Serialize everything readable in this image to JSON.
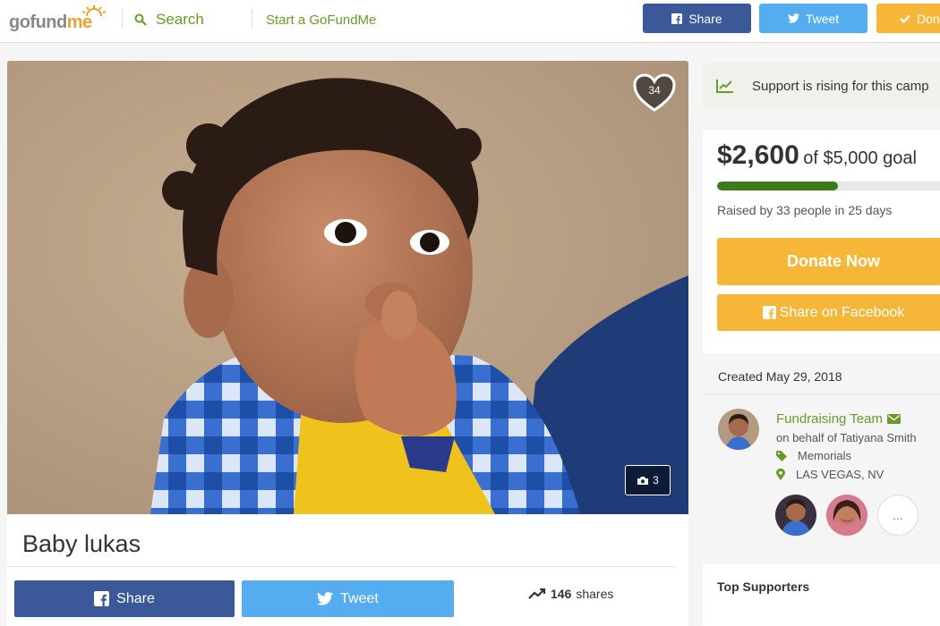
{
  "header": {
    "logo": "gofundme",
    "search_label": "Search",
    "start_label": "Start a GoFundMe",
    "share_label": "Share",
    "tweet_label": "Tweet",
    "donate_label": "Don"
  },
  "campaign": {
    "title": "Baby lukas",
    "heart_count": "34",
    "photo_count": "3",
    "share_label": "Share",
    "tweet_label": "Tweet",
    "shares_count": "146",
    "shares_label": "shares"
  },
  "sidebar": {
    "rising_text": "Support is rising for this camp",
    "raised_amount": "$2,600",
    "goal_text": "of $5,000 goal",
    "progress_fraction": 0.52,
    "raised_by": "Raised by 33 people in 25 days",
    "donate_now": "Donate Now",
    "share_facebook": "Share on Facebook",
    "created": "Created May 29, 2018",
    "team_label": "Fundraising Team",
    "behalf": "on behalf of Tatiyana Smith",
    "category": "Memorials",
    "location": "LAS VEGAS, NV",
    "more": "...",
    "top_supporters": "Top Supporters"
  },
  "colors": {
    "facebook": "#3b5998",
    "twitter": "#55acee",
    "donate": "#f6b638",
    "brand_green": "#6a9a2a",
    "progress": "#3d7a1c"
  },
  "icons": [
    "search-icon",
    "facebook-icon",
    "twitter-icon",
    "check-icon",
    "heart-icon",
    "camera-icon",
    "trending-icon",
    "chart-icon",
    "envelope-icon",
    "tag-icon",
    "location-pin-icon"
  ]
}
